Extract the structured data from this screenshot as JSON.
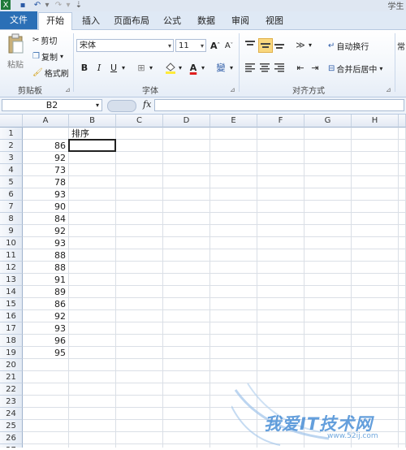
{
  "titlebar": {
    "right_text": "学生"
  },
  "tabs": [
    {
      "label": "文件"
    },
    {
      "label": "开始"
    },
    {
      "label": "插入"
    },
    {
      "label": "页面布局"
    },
    {
      "label": "公式"
    },
    {
      "label": "数据"
    },
    {
      "label": "审阅"
    },
    {
      "label": "视图"
    }
  ],
  "ribbon": {
    "clipboard": {
      "paste": "粘贴",
      "cut": "剪切",
      "copy": "复制",
      "format_painter": "格式刷",
      "group_label": "剪贴板"
    },
    "font": {
      "font_name": "宋体",
      "font_size": "11",
      "bold": "B",
      "italic": "I",
      "underline": "U",
      "group_label": "字体"
    },
    "alignment": {
      "wrap_text": "自动换行",
      "merge_center": "合并后居中",
      "group_label": "对齐方式"
    },
    "number": {
      "format": "常"
    }
  },
  "formula_bar": {
    "name_box": "B2",
    "fx": "fx",
    "formula": ""
  },
  "columns": [
    "A",
    "B",
    "C",
    "D",
    "E",
    "F",
    "G",
    "H"
  ],
  "rows": [
    {
      "n": "1",
      "a": "",
      "b": "排序"
    },
    {
      "n": "2",
      "a": "86",
      "b": ""
    },
    {
      "n": "3",
      "a": "92",
      "b": ""
    },
    {
      "n": "4",
      "a": "73",
      "b": ""
    },
    {
      "n": "5",
      "a": "78",
      "b": ""
    },
    {
      "n": "6",
      "a": "93",
      "b": ""
    },
    {
      "n": "7",
      "a": "90",
      "b": ""
    },
    {
      "n": "8",
      "a": "84",
      "b": ""
    },
    {
      "n": "9",
      "a": "92",
      "b": ""
    },
    {
      "n": "10",
      "a": "93",
      "b": ""
    },
    {
      "n": "11",
      "a": "88",
      "b": ""
    },
    {
      "n": "12",
      "a": "88",
      "b": ""
    },
    {
      "n": "13",
      "a": "91",
      "b": ""
    },
    {
      "n": "14",
      "a": "89",
      "b": ""
    },
    {
      "n": "15",
      "a": "86",
      "b": ""
    },
    {
      "n": "16",
      "a": "92",
      "b": ""
    },
    {
      "n": "17",
      "a": "93",
      "b": ""
    },
    {
      "n": "18",
      "a": "96",
      "b": ""
    },
    {
      "n": "19",
      "a": "95",
      "b": ""
    },
    {
      "n": "20",
      "a": "",
      "b": ""
    },
    {
      "n": "21",
      "a": "",
      "b": ""
    },
    {
      "n": "22",
      "a": "",
      "b": ""
    },
    {
      "n": "23",
      "a": "",
      "b": ""
    },
    {
      "n": "24",
      "a": "",
      "b": ""
    },
    {
      "n": "25",
      "a": "",
      "b": ""
    },
    {
      "n": "26",
      "a": "",
      "b": ""
    },
    {
      "n": "27",
      "a": "",
      "b": ""
    }
  ],
  "selected_cell": "B2",
  "watermark": {
    "text": "我爱IT技术网",
    "url": "www.52ij.com"
  },
  "colors": {
    "file_tab": "#2b6fb6",
    "grid_line": "#dadfe6",
    "header_bg": "#e3eaf4"
  }
}
